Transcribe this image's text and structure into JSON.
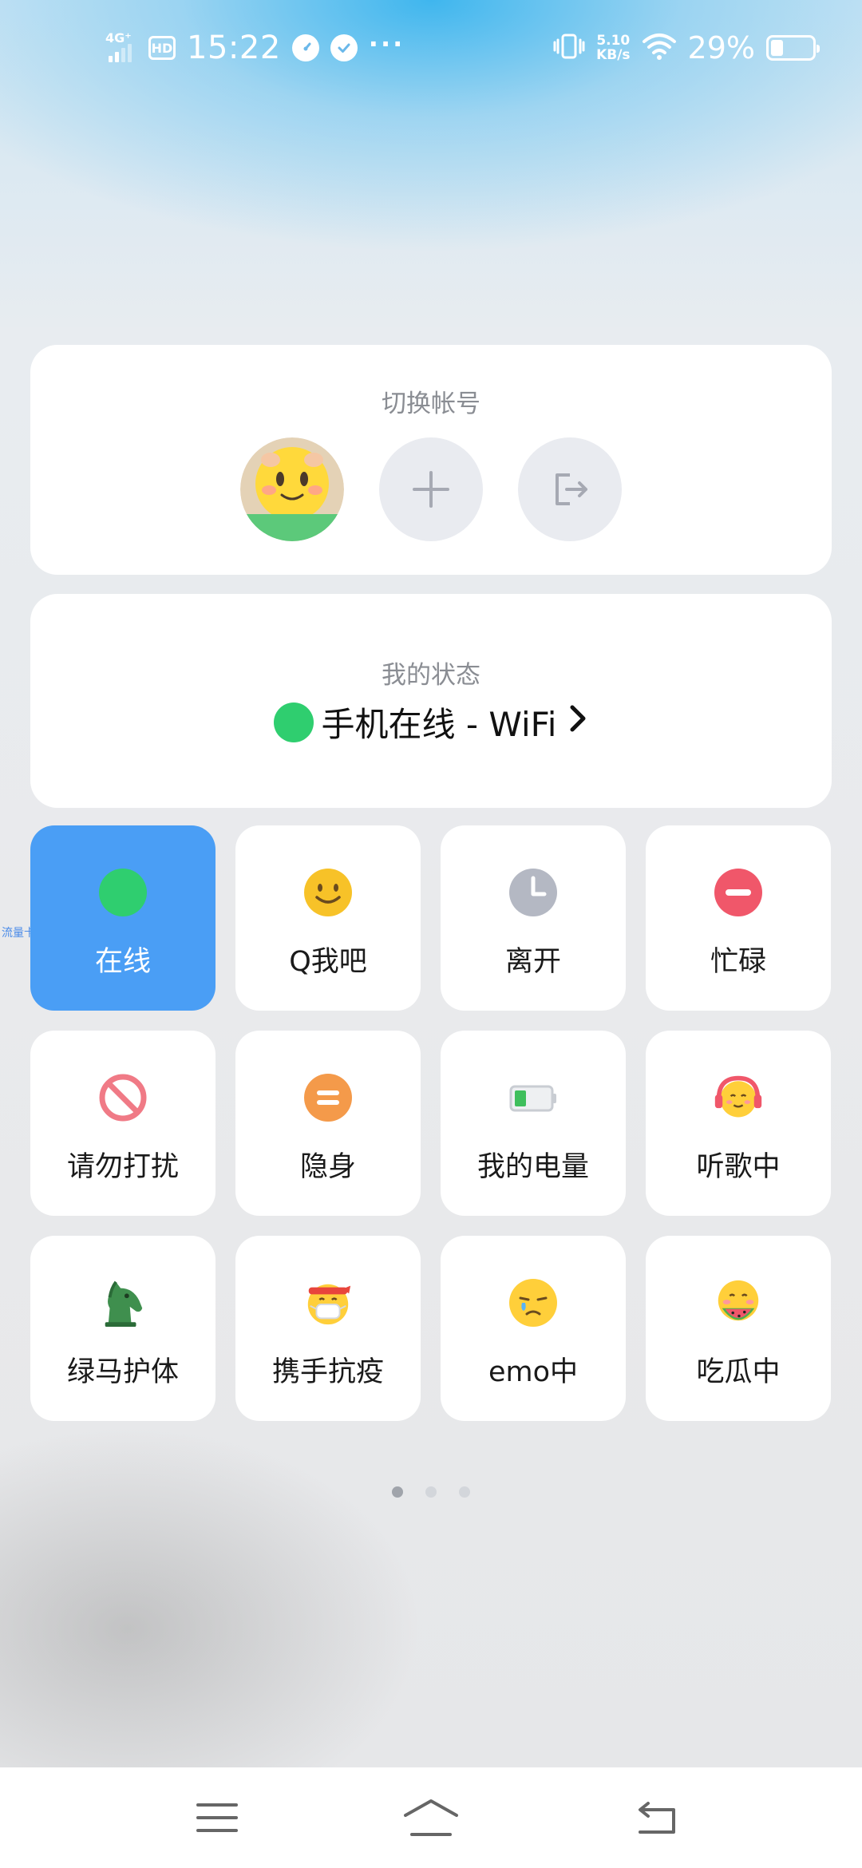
{
  "status_bar": {
    "network": "4G⁺",
    "hd": "HD",
    "time": "15:22",
    "more": "···",
    "speed_value": "5.10",
    "speed_unit": "KB/s",
    "battery_percent": "29%",
    "battery_level": 0.29
  },
  "account": {
    "title": "切换帐号",
    "avatar_badge": "∞"
  },
  "my_status": {
    "title": "我的状态",
    "current": "手机在线 - WiFi",
    "chevron": "›",
    "dot_color": "#2fce6f"
  },
  "tiles": [
    {
      "label": "在线",
      "icon": "online-dot-icon",
      "active": true
    },
    {
      "label": "Q我吧",
      "icon": "smile-icon",
      "active": false
    },
    {
      "label": "离开",
      "icon": "clock-icon",
      "active": false
    },
    {
      "label": "忙碌",
      "icon": "busy-icon",
      "active": false
    },
    {
      "label": "请勿打扰",
      "icon": "no-disturb-icon",
      "active": false
    },
    {
      "label": "隐身",
      "icon": "invisible-icon",
      "active": false
    },
    {
      "label": "我的电量",
      "icon": "battery-icon",
      "active": false
    },
    {
      "label": "听歌中",
      "icon": "headphones-emoji-icon",
      "active": false
    },
    {
      "label": "绿马护体",
      "icon": "horse-icon",
      "active": false
    },
    {
      "label": "携手抗疫",
      "icon": "mask-emoji-icon",
      "active": false
    },
    {
      "label": "emo中",
      "icon": "sad-emoji-icon",
      "active": false
    },
    {
      "label": "吃瓜中",
      "icon": "watermelon-emoji-icon",
      "active": false
    }
  ],
  "floating_label": "流量卡片",
  "pager": {
    "pages": 3,
    "current": 1
  },
  "colors": {
    "active_tile": "#4a9ef5",
    "online_green": "#2fce6f",
    "busy_red": "#f0576a",
    "invisible_orange": "#f49a4a"
  }
}
